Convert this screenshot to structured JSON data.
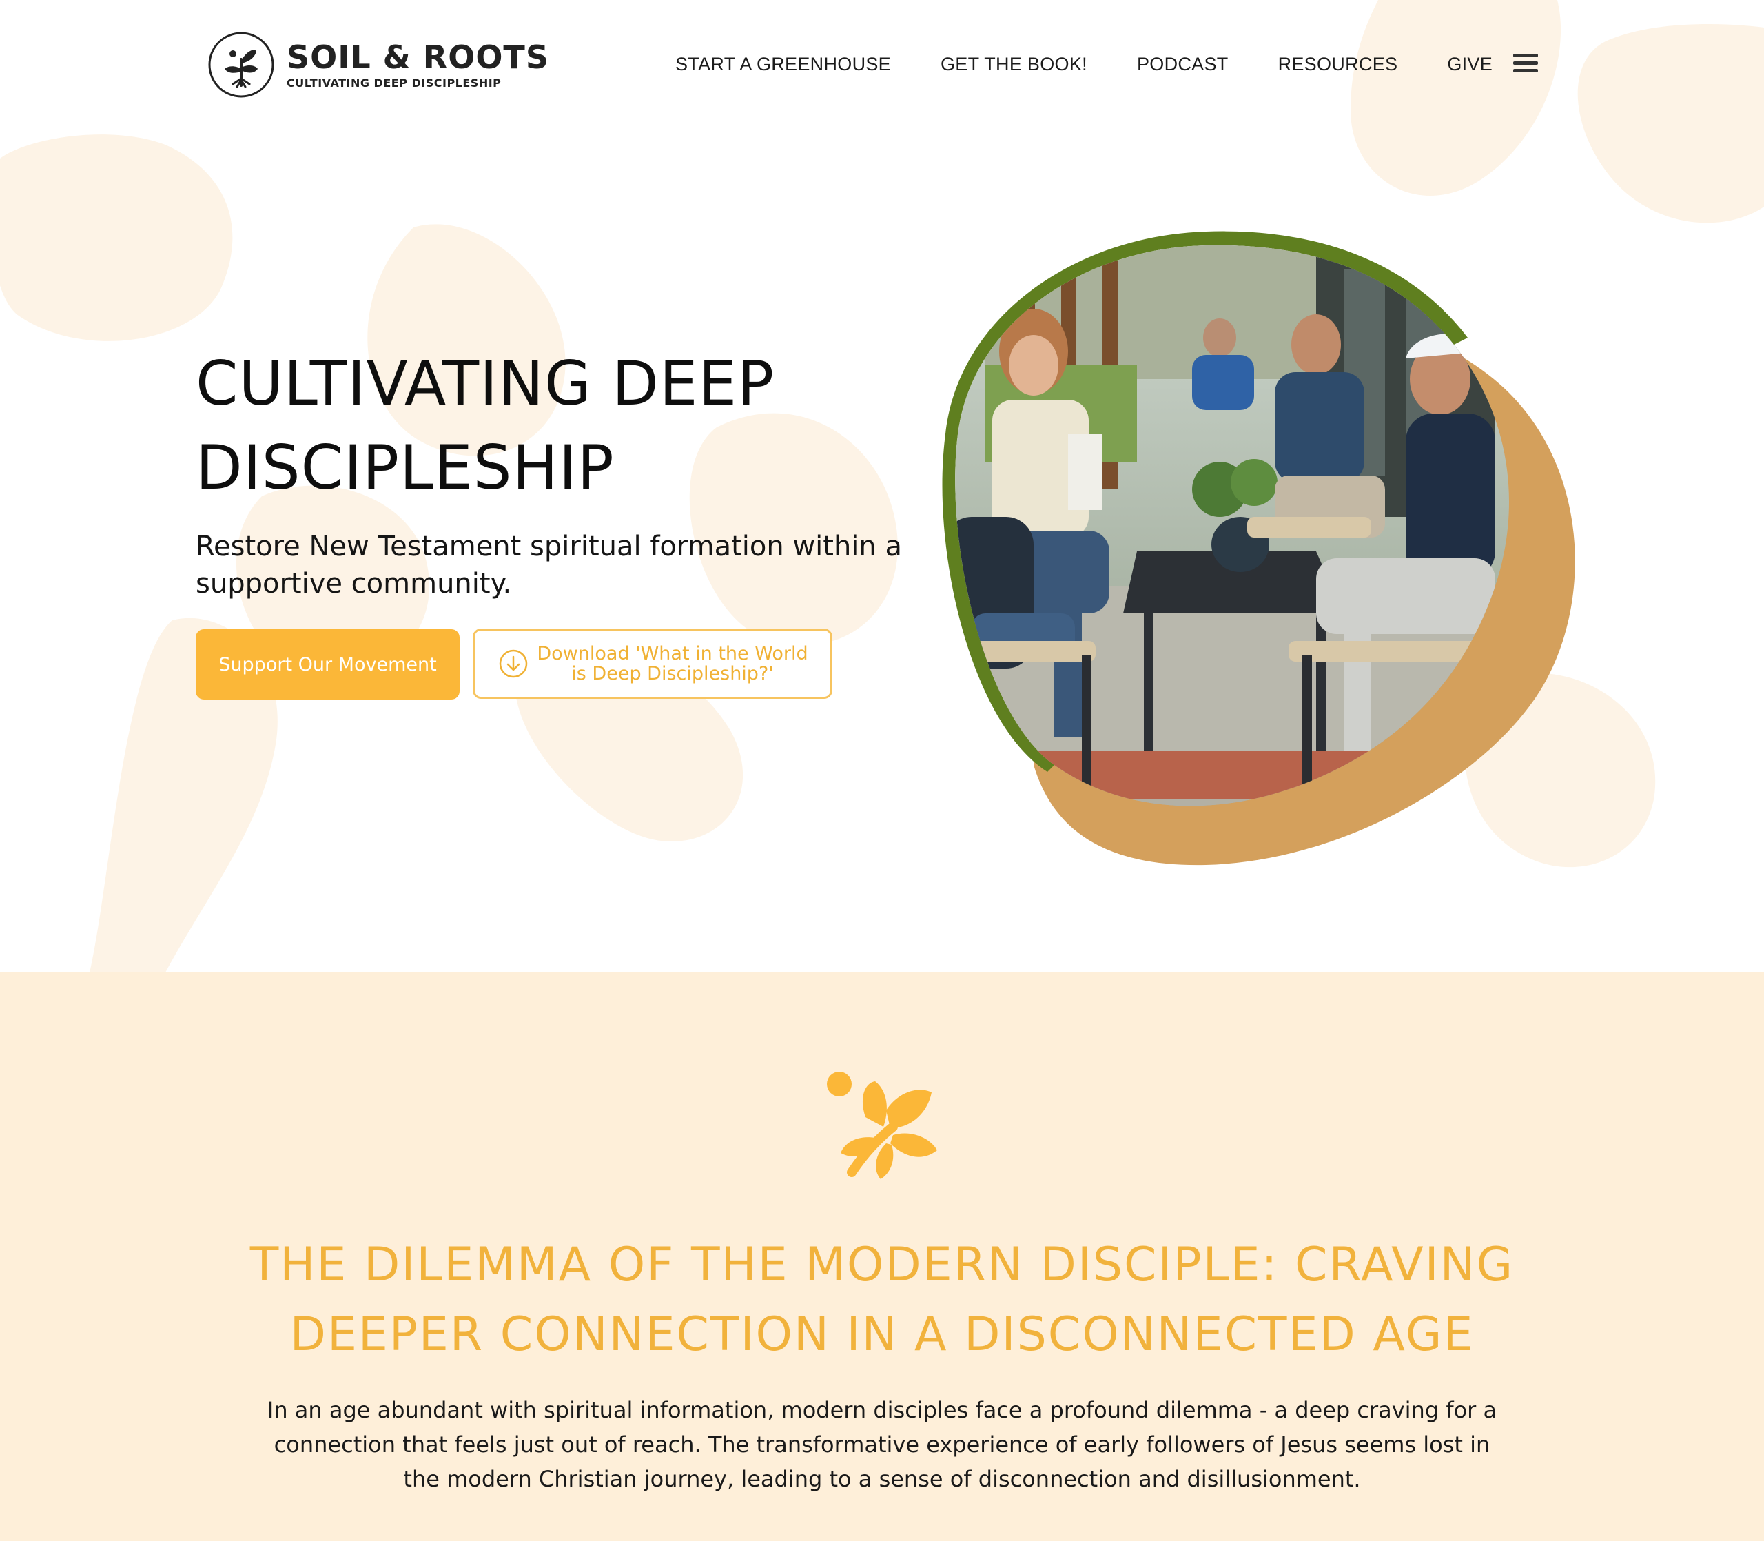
{
  "brand": {
    "name": "SOIL & ROOTS",
    "tagline": "CULTIVATING DEEP DISCIPLESHIP",
    "logo_icon": "leaf-sprout-icon"
  },
  "nav": {
    "items": [
      {
        "label": "START A GREENHOUSE"
      },
      {
        "label": "GET THE BOOK!"
      },
      {
        "label": "PODCAST"
      },
      {
        "label": "RESOURCES"
      },
      {
        "label": "GIVE"
      }
    ],
    "menu_icon": "hamburger-menu-icon"
  },
  "hero": {
    "title": "CULTIVATING DEEP DISCIPLESHIP",
    "subtitle": "Restore New Testament spiritual formation within a supportive community.",
    "primary_button": "Support Our Movement",
    "secondary_button": "Download 'What in the World is Deep Discipleship?'",
    "secondary_button_icon": "download-circle-icon",
    "photo_icon": "group-discussion-photo"
  },
  "dilemma": {
    "icon": "leaf-sprout-icon",
    "title": "THE DILEMMA OF THE MODERN DISCIPLE: CRAVING DEEPER CONNECTION IN A DISCONNECTED AGE",
    "body": "In an age abundant with spiritual information, modern disciples face a profound dilemma - a deep craving for a connection that feels just out of reach. The transformative experience of early followers of Jesus seems lost in the modern Christian journey, leading to a sense of disconnection and disillusionment."
  },
  "colors": {
    "accent": "#fbb738",
    "accent_text": "#f1b23c",
    "section_bg": "#feefd9",
    "photo_ring_green": "#5f7f1f",
    "photo_blob_tan": "#d4a05c"
  }
}
